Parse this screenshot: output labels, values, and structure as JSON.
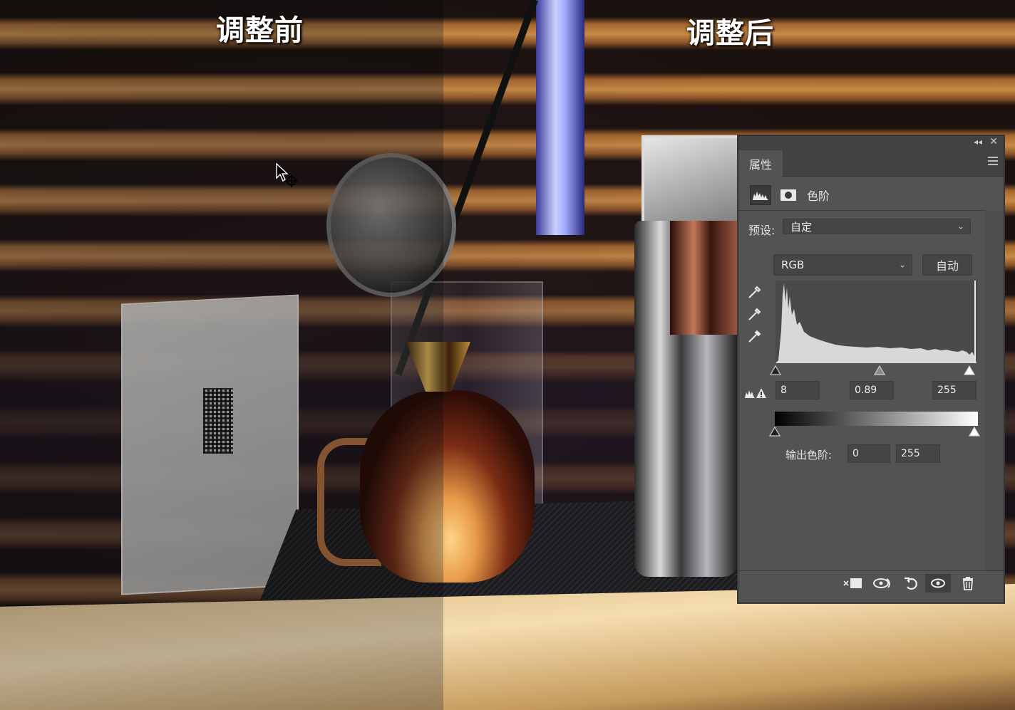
{
  "captions": {
    "before": "调整前",
    "after": "调整后"
  },
  "panel": {
    "tab_label": "属性",
    "adjustment_title": "色阶",
    "preset_label": "预设:",
    "preset_value": "自定",
    "channel_value": "RGB",
    "auto_label": "自动",
    "input_levels": {
      "black": "8",
      "gamma": "0.89",
      "white": "255"
    },
    "output_label": "输出色阶:",
    "output_levels": {
      "black": "0",
      "white": "255"
    },
    "icons": {
      "collapse": "double-chevron-left-icon",
      "close": "close-icon",
      "menu": "panel-menu-icon",
      "levels": "levels-histogram-icon",
      "mask": "layer-mask-icon",
      "eyedropper_black": "black-point-eyedropper-icon",
      "eyedropper_gray": "gray-point-eyedropper-icon",
      "eyedropper_white": "white-point-eyedropper-icon",
      "clipping": "clipping-warning-icon",
      "clip_to_layer": "clip-to-layer-icon",
      "view_previous": "view-previous-state-icon",
      "reset": "reset-icon",
      "visibility": "eye-icon",
      "delete": "trash-icon"
    }
  },
  "colors": {
    "panel_bg": "#535353",
    "panel_dark": "#424242",
    "field_bg": "#454545"
  }
}
